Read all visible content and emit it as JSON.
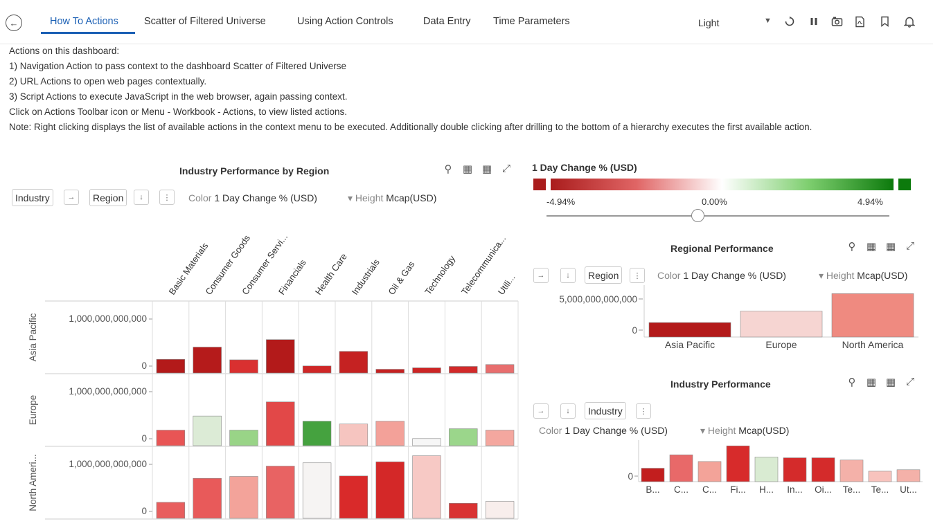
{
  "tabs": [
    {
      "label": "How To Actions",
      "active": true
    },
    {
      "label": "Scatter of Filtered Universe",
      "active": false
    },
    {
      "label": "Using Action Controls",
      "active": false
    },
    {
      "label": "Data Entry",
      "active": false
    },
    {
      "label": "Time Parameters",
      "active": false
    }
  ],
  "theme": {
    "selected": "Light"
  },
  "toolbar_icons": [
    "refresh-icon",
    "pause-icon",
    "snapshot-icon",
    "pdf-icon",
    "bookmark-icon",
    "bell-icon"
  ],
  "description": [
    "Actions on this dashboard:",
    "1) Navigation Action to pass context to the dashboard Scatter of Filtered Universe",
    "2) URL Actions to open web pages contextually.",
    "3) Script Actions to execute JavaScript in the web browser, again passing context.",
    "Click on Actions Toolbar icon or Menu - Workbook - Actions, to view listed actions.",
    "Note: Right clicking displays the list of available actions in the context menu to be executed.   Additionally double clicking after drilling to the bottom of a hierarchy executes the first available action."
  ],
  "industry_by_region": {
    "title": "Industry Performance by Region",
    "controls": {
      "dim1": "Industry",
      "dim2": "Region",
      "color_label": "Color",
      "color_value": "1 Day Change % (USD)",
      "height_label": "Height",
      "height_value": "Mcap(USD)"
    }
  },
  "color_scale": {
    "title": "1 Day Change % (USD)",
    "min_label": "-4.94%",
    "mid_label": "0.00%",
    "max_label": "4.94%",
    "low_color": "#aa1d1d",
    "high_color": "#0c7a0c"
  },
  "regional": {
    "title": "Regional Performance",
    "controls": {
      "dim": "Region",
      "color_label": "Color",
      "color_value": "1 Day Change % (USD)",
      "height_label": "Height",
      "height_value": "Mcap(USD)"
    }
  },
  "industry_perf": {
    "title": "Industry Performance",
    "controls": {
      "dim": "Industry",
      "color_label": "Color",
      "color_value": "1 Day Change % (USD)",
      "height_label": "Height",
      "height_value": "Mcap(USD)"
    }
  },
  "chart_data": [
    {
      "type": "bar",
      "title": "Industry Performance by Region",
      "categories": [
        "Basic Materials",
        "Consumer Goods",
        "Consumer Servi...",
        "Financials",
        "Health Care",
        "Industrials",
        "Oil & Gas",
        "Technology",
        "Telecommunica...",
        "Utili..."
      ],
      "rows": [
        "Asia Pacific",
        "Europe",
        "North Ameri..."
      ],
      "y_ticks": [
        "1,000,000,000,000",
        "0"
      ],
      "ylim": [
        0,
        1250000000000
      ],
      "series": [
        {
          "values": [
            290000000000,
            550000000000,
            280000000000,
            710000000000,
            150000000000,
            460000000000,
            80000000000,
            110000000000,
            140000000000,
            180000000000
          ],
          "colors": [
            "#b31a1a",
            "#b51b1b",
            "#d93030",
            "#b31a1a",
            "#cf2727",
            "#c52222",
            "#c52222",
            "#cc2525",
            "#d22a2a",
            "#e86e6e"
          ]
        },
        {
          "values": [
            330000000000,
            630000000000,
            330000000000,
            930000000000,
            520000000000,
            460000000000,
            520000000000,
            150000000000,
            360000000000,
            330000000000
          ],
          "colors": [
            "#e85555",
            "#dcebd6",
            "#99d487",
            "#e24848",
            "#45a23f",
            "#f6c5c0",
            "#f3a199",
            "#f6f6f6",
            "#9bd68b",
            "#f4a79f"
          ]
        },
        {
          "values": [
            340000000000,
            850000000000,
            890000000000,
            1110000000000,
            1180000000000,
            900000000000,
            1200000000000,
            1330000000000,
            320000000000,
            360000000000
          ],
          "colors": [
            "#e85e5e",
            "#e85a5a",
            "#f3a39a",
            "#e86363",
            "#f6f4f3",
            "#d92a2a",
            "#d42828",
            "#f7c9c5",
            "#d93333",
            "#f8eeec"
          ]
        }
      ]
    },
    {
      "type": "bar",
      "title": "Regional Performance",
      "categories": [
        "Asia Pacific",
        "Europe",
        "North America"
      ],
      "values": [
        1900000000000,
        3400000000000,
        5700000000000
      ],
      "colors": [
        "#b31a1a",
        "#f6d5d2",
        "#ef8a80"
      ],
      "y_ticks": [
        "5,000,000,000,000",
        "0"
      ],
      "ylim": [
        0,
        6000000000000
      ]
    },
    {
      "type": "bar",
      "title": "Industry Performance",
      "categories": [
        "B...",
        "C...",
        "C...",
        "Fi...",
        "H...",
        "In...",
        "Oi...",
        "Te...",
        "Te...",
        "Ut..."
      ],
      "values": [
        0.9,
        1.8,
        1.35,
        2.4,
        1.65,
        1.6,
        1.6,
        1.45,
        0.7,
        0.8
      ],
      "colors": [
        "#c21e1e",
        "#e86969",
        "#f3a399",
        "#d72b2b",
        "#d9ebd2",
        "#d42b2b",
        "#d42b2b",
        "#f4b1a9",
        "#f8c3bd",
        "#f4b1a9"
      ],
      "y_ticks": [
        "0"
      ],
      "ylim": [
        0,
        2.6
      ]
    }
  ]
}
